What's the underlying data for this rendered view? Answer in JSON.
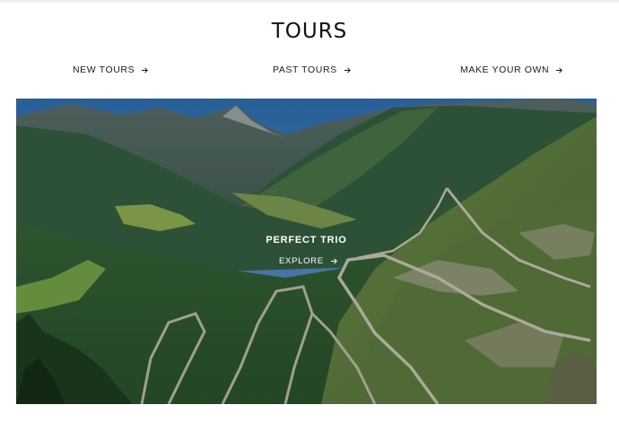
{
  "page": {
    "title": "TOURS"
  },
  "nav": {
    "items": [
      {
        "label": "NEW TOURS",
        "icon": "arrow-right-icon"
      },
      {
        "label": "PAST TOURS",
        "icon": "arrow-right-icon"
      },
      {
        "label": "MAKE YOUR OWN",
        "icon": "arrow-right-icon"
      }
    ]
  },
  "hero": {
    "title": "PERFECT TRIO",
    "cta_label": "EXPLORE",
    "cta_icon": "arrow-right-icon",
    "image": "mountain-pass-switchbacks-photo"
  }
}
